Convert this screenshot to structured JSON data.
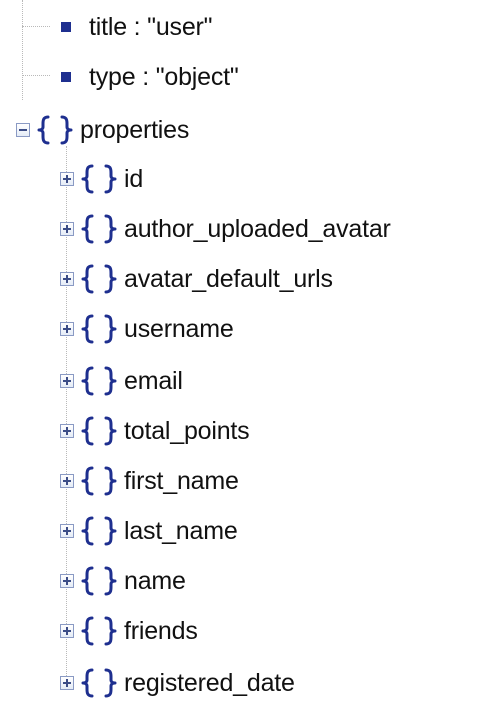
{
  "tree": {
    "attributes": [
      {
        "text": "title : \"user\"",
        "icon": "square-bullet-icon"
      },
      {
        "text": "type : \"object\"",
        "icon": "square-bullet-icon"
      }
    ],
    "properties_node": {
      "label": "properties",
      "state": "expanded",
      "icon": "object-braces-icon"
    },
    "children": [
      {
        "label": "id",
        "state": "collapsed"
      },
      {
        "label": "author_uploaded_avatar",
        "state": "collapsed"
      },
      {
        "label": "avatar_default_urls",
        "state": "collapsed"
      },
      {
        "label": "username",
        "state": "collapsed"
      },
      {
        "label": "email",
        "state": "collapsed"
      },
      {
        "label": "total_points",
        "state": "collapsed"
      },
      {
        "label": "first_name",
        "state": "collapsed"
      },
      {
        "label": "last_name",
        "state": "collapsed"
      },
      {
        "label": "name",
        "state": "collapsed"
      },
      {
        "label": "friends",
        "state": "collapsed"
      },
      {
        "label": "registered_date",
        "state": "collapsed"
      }
    ]
  },
  "colors": {
    "brace": "#1e2f8f",
    "guide_line": "#b9b9b9",
    "text": "#111111"
  }
}
